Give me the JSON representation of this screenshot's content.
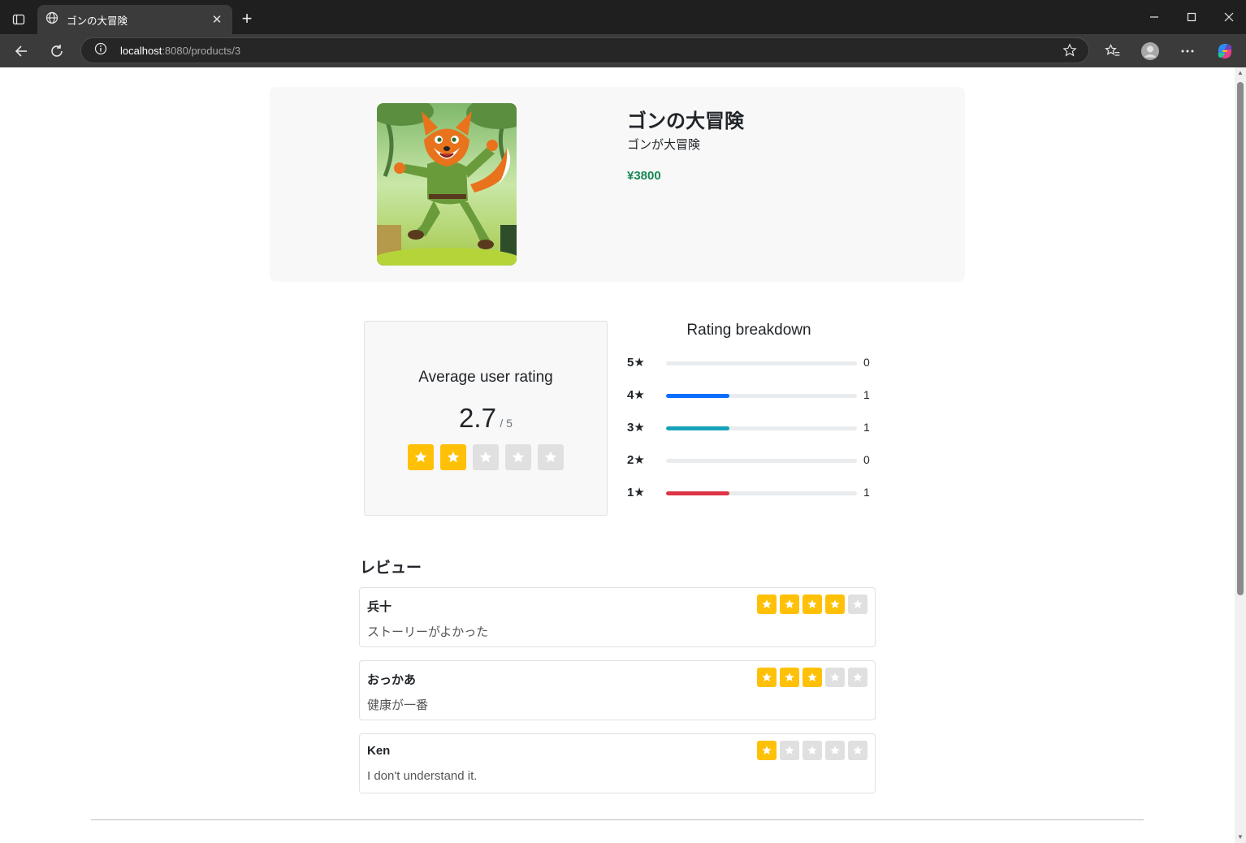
{
  "browser": {
    "tab_title": "ゴンの大冒険",
    "url_host": "localhost",
    "url_path": ":8080/products/3"
  },
  "product": {
    "title": "ゴンの大冒険",
    "subtitle": "ゴンが大冒険",
    "price": "¥3800",
    "image_icon": "fox-adventurer-illustration"
  },
  "rating": {
    "avg_title": "Average user rating",
    "avg_value": "2.7",
    "avg_max": "/ 5",
    "avg_stars": [
      true,
      true,
      false,
      false,
      false
    ],
    "breakdown_title": "Rating breakdown",
    "breakdown": [
      {
        "label": "5★",
        "count": "0",
        "fraction": 0,
        "color": "#0d6efd"
      },
      {
        "label": "4★",
        "count": "1",
        "fraction": 0.333,
        "color": "#0d6efd"
      },
      {
        "label": "3★",
        "count": "1",
        "fraction": 0.333,
        "color": "#17a2b8"
      },
      {
        "label": "2★",
        "count": "0",
        "fraction": 0,
        "color": "#ffc107"
      },
      {
        "label": "1★",
        "count": "1",
        "fraction": 0.333,
        "color": "#dc3545"
      }
    ]
  },
  "reviews": {
    "heading": "レビュー",
    "items": [
      {
        "name": "兵十",
        "body": "ストーリーがよかった",
        "stars": 4
      },
      {
        "name": "おっかあ",
        "body": "健康が一番",
        "stars": 3
      },
      {
        "name": "Ken",
        "body": "I don't understand it.",
        "stars": 1
      }
    ]
  },
  "colors": {
    "star_on": "#ffc107",
    "star_off": "#e0e0e0",
    "price": "#198754"
  }
}
